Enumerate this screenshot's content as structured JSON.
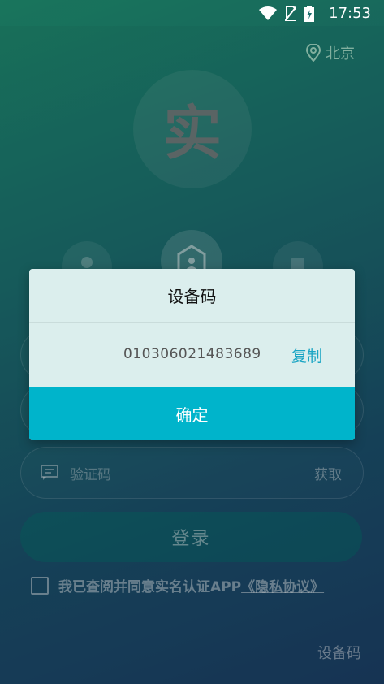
{
  "status_bar": {
    "time": "17:53"
  },
  "header": {
    "location": "北京"
  },
  "logo": {
    "text": "实"
  },
  "form": {
    "code_placeholder": "验证码",
    "get_code": "获取",
    "login": "登录",
    "agreement_prefix": "我已查阅并同意实名认证APP",
    "agreement_link": "《隐私协议》"
  },
  "footer": {
    "device_code": "设备码"
  },
  "dialog": {
    "title": "设备码",
    "code": "010306021483689",
    "copy": "复制",
    "confirm": "确定"
  }
}
